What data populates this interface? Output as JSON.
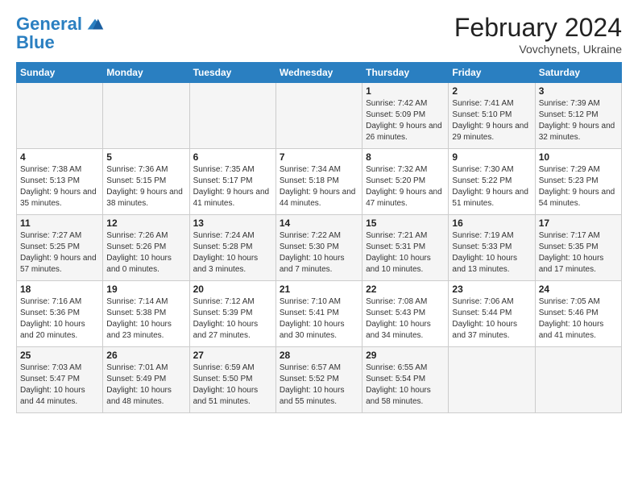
{
  "header": {
    "logo_line1": "General",
    "logo_line2": "Blue",
    "title": "February 2024",
    "subtitle": "Vovchynets, Ukraine"
  },
  "weekdays": [
    "Sunday",
    "Monday",
    "Tuesday",
    "Wednesday",
    "Thursday",
    "Friday",
    "Saturday"
  ],
  "weeks": [
    [
      {
        "day": "",
        "sunrise": "",
        "sunset": "",
        "daylight": ""
      },
      {
        "day": "",
        "sunrise": "",
        "sunset": "",
        "daylight": ""
      },
      {
        "day": "",
        "sunrise": "",
        "sunset": "",
        "daylight": ""
      },
      {
        "day": "",
        "sunrise": "",
        "sunset": "",
        "daylight": ""
      },
      {
        "day": "1",
        "sunrise": "Sunrise: 7:42 AM",
        "sunset": "Sunset: 5:09 PM",
        "daylight": "Daylight: 9 hours and 26 minutes."
      },
      {
        "day": "2",
        "sunrise": "Sunrise: 7:41 AM",
        "sunset": "Sunset: 5:10 PM",
        "daylight": "Daylight: 9 hours and 29 minutes."
      },
      {
        "day": "3",
        "sunrise": "Sunrise: 7:39 AM",
        "sunset": "Sunset: 5:12 PM",
        "daylight": "Daylight: 9 hours and 32 minutes."
      }
    ],
    [
      {
        "day": "4",
        "sunrise": "Sunrise: 7:38 AM",
        "sunset": "Sunset: 5:13 PM",
        "daylight": "Daylight: 9 hours and 35 minutes."
      },
      {
        "day": "5",
        "sunrise": "Sunrise: 7:36 AM",
        "sunset": "Sunset: 5:15 PM",
        "daylight": "Daylight: 9 hours and 38 minutes."
      },
      {
        "day": "6",
        "sunrise": "Sunrise: 7:35 AM",
        "sunset": "Sunset: 5:17 PM",
        "daylight": "Daylight: 9 hours and 41 minutes."
      },
      {
        "day": "7",
        "sunrise": "Sunrise: 7:34 AM",
        "sunset": "Sunset: 5:18 PM",
        "daylight": "Daylight: 9 hours and 44 minutes."
      },
      {
        "day": "8",
        "sunrise": "Sunrise: 7:32 AM",
        "sunset": "Sunset: 5:20 PM",
        "daylight": "Daylight: 9 hours and 47 minutes."
      },
      {
        "day": "9",
        "sunrise": "Sunrise: 7:30 AM",
        "sunset": "Sunset: 5:22 PM",
        "daylight": "Daylight: 9 hours and 51 minutes."
      },
      {
        "day": "10",
        "sunrise": "Sunrise: 7:29 AM",
        "sunset": "Sunset: 5:23 PM",
        "daylight": "Daylight: 9 hours and 54 minutes."
      }
    ],
    [
      {
        "day": "11",
        "sunrise": "Sunrise: 7:27 AM",
        "sunset": "Sunset: 5:25 PM",
        "daylight": "Daylight: 9 hours and 57 minutes."
      },
      {
        "day": "12",
        "sunrise": "Sunrise: 7:26 AM",
        "sunset": "Sunset: 5:26 PM",
        "daylight": "Daylight: 10 hours and 0 minutes."
      },
      {
        "day": "13",
        "sunrise": "Sunrise: 7:24 AM",
        "sunset": "Sunset: 5:28 PM",
        "daylight": "Daylight: 10 hours and 3 minutes."
      },
      {
        "day": "14",
        "sunrise": "Sunrise: 7:22 AM",
        "sunset": "Sunset: 5:30 PM",
        "daylight": "Daylight: 10 hours and 7 minutes."
      },
      {
        "day": "15",
        "sunrise": "Sunrise: 7:21 AM",
        "sunset": "Sunset: 5:31 PM",
        "daylight": "Daylight: 10 hours and 10 minutes."
      },
      {
        "day": "16",
        "sunrise": "Sunrise: 7:19 AM",
        "sunset": "Sunset: 5:33 PM",
        "daylight": "Daylight: 10 hours and 13 minutes."
      },
      {
        "day": "17",
        "sunrise": "Sunrise: 7:17 AM",
        "sunset": "Sunset: 5:35 PM",
        "daylight": "Daylight: 10 hours and 17 minutes."
      }
    ],
    [
      {
        "day": "18",
        "sunrise": "Sunrise: 7:16 AM",
        "sunset": "Sunset: 5:36 PM",
        "daylight": "Daylight: 10 hours and 20 minutes."
      },
      {
        "day": "19",
        "sunrise": "Sunrise: 7:14 AM",
        "sunset": "Sunset: 5:38 PM",
        "daylight": "Daylight: 10 hours and 23 minutes."
      },
      {
        "day": "20",
        "sunrise": "Sunrise: 7:12 AM",
        "sunset": "Sunset: 5:39 PM",
        "daylight": "Daylight: 10 hours and 27 minutes."
      },
      {
        "day": "21",
        "sunrise": "Sunrise: 7:10 AM",
        "sunset": "Sunset: 5:41 PM",
        "daylight": "Daylight: 10 hours and 30 minutes."
      },
      {
        "day": "22",
        "sunrise": "Sunrise: 7:08 AM",
        "sunset": "Sunset: 5:43 PM",
        "daylight": "Daylight: 10 hours and 34 minutes."
      },
      {
        "day": "23",
        "sunrise": "Sunrise: 7:06 AM",
        "sunset": "Sunset: 5:44 PM",
        "daylight": "Daylight: 10 hours and 37 minutes."
      },
      {
        "day": "24",
        "sunrise": "Sunrise: 7:05 AM",
        "sunset": "Sunset: 5:46 PM",
        "daylight": "Daylight: 10 hours and 41 minutes."
      }
    ],
    [
      {
        "day": "25",
        "sunrise": "Sunrise: 7:03 AM",
        "sunset": "Sunset: 5:47 PM",
        "daylight": "Daylight: 10 hours and 44 minutes."
      },
      {
        "day": "26",
        "sunrise": "Sunrise: 7:01 AM",
        "sunset": "Sunset: 5:49 PM",
        "daylight": "Daylight: 10 hours and 48 minutes."
      },
      {
        "day": "27",
        "sunrise": "Sunrise: 6:59 AM",
        "sunset": "Sunset: 5:50 PM",
        "daylight": "Daylight: 10 hours and 51 minutes."
      },
      {
        "day": "28",
        "sunrise": "Sunrise: 6:57 AM",
        "sunset": "Sunset: 5:52 PM",
        "daylight": "Daylight: 10 hours and 55 minutes."
      },
      {
        "day": "29",
        "sunrise": "Sunrise: 6:55 AM",
        "sunset": "Sunset: 5:54 PM",
        "daylight": "Daylight: 10 hours and 58 minutes."
      },
      {
        "day": "",
        "sunrise": "",
        "sunset": "",
        "daylight": ""
      },
      {
        "day": "",
        "sunrise": "",
        "sunset": "",
        "daylight": ""
      }
    ]
  ]
}
